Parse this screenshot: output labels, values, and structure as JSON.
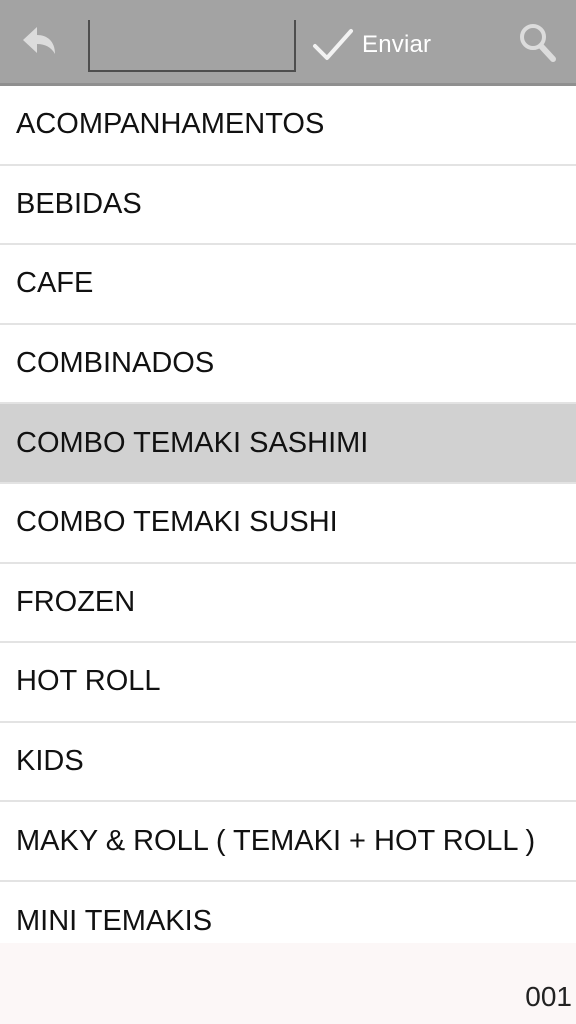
{
  "toolbar": {
    "back_icon": "undo-arrow-icon",
    "search_value": "",
    "send_icon": "check-icon",
    "send_label": "Enviar",
    "search_icon": "magnifier-icon",
    "bg_color": "#a3a3a3"
  },
  "list": {
    "items": [
      {
        "label": "ACOMPANHAMENTOS"
      },
      {
        "label": "BEBIDAS"
      },
      {
        "label": "CAFE"
      },
      {
        "label": "COMBINADOS"
      },
      {
        "label": "COMBO TEMAKI SASHIMI",
        "selected": true
      },
      {
        "label": "COMBO TEMAKI SUSHI"
      },
      {
        "label": "FROZEN"
      },
      {
        "label": "HOT ROLL"
      },
      {
        "label": "KIDS"
      },
      {
        "label": "MAKY & ROLL ( TEMAKI + HOT ROLL )"
      },
      {
        "label": "MINI TEMAKIS"
      }
    ],
    "selected_color": "#d1d1d1"
  },
  "footer": {
    "code": "001"
  }
}
